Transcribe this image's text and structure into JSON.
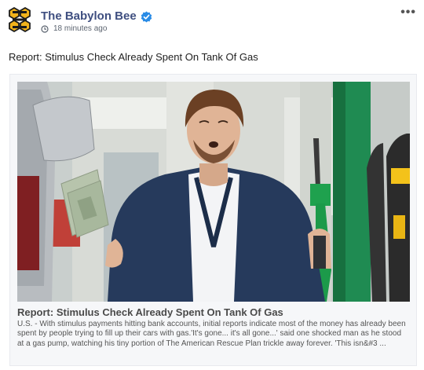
{
  "post": {
    "page_name": "The Babylon Bee",
    "time": "18 minutes ago",
    "more_label": "•••",
    "text": "Report: Stimulus Check Already Spent On Tank Of Gas"
  },
  "link": {
    "title": "Report: Stimulus Check Already Spent On Tank Of Gas",
    "description": "U.S. - With stimulus payments hitting bank accounts, initial reports indicate most of the money has already been spent by people trying to fill up their cars with gas.'It's gone... it's all gone...' said one shocked man as he stood at a gas pump, watching his tiny portion of The American Rescue Plan trickle away forever. 'This isn&#3 ..."
  },
  "icons": {
    "logo": "babylon-bee-logo",
    "verified": "verified-check-icon",
    "clock": "clock-icon",
    "more": "more-options-icon"
  },
  "colors": {
    "page_name": "#3f4f80",
    "verified": "#2a8ce6",
    "logo_yellow": "#f2b31b"
  }
}
